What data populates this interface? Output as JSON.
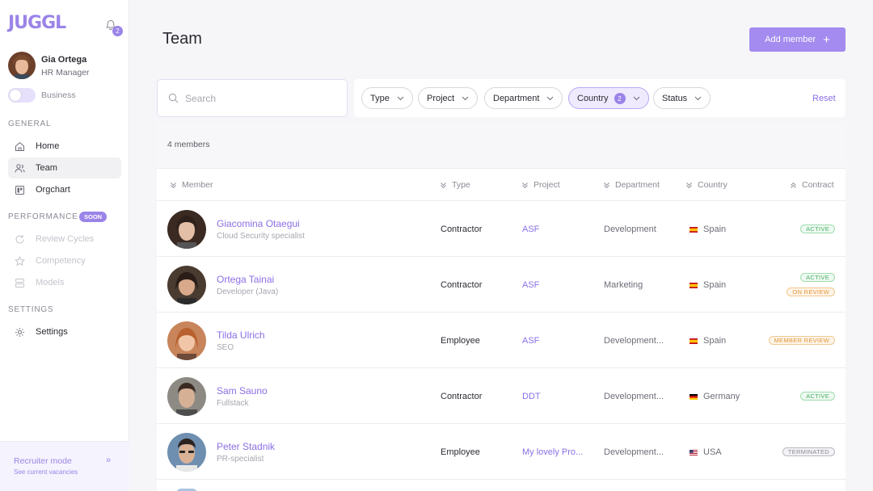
{
  "app": {
    "logo": "JUGGL",
    "notifications_count": "2"
  },
  "user": {
    "name": "Gia Ortega",
    "role": "HR Manager",
    "mode_label": "Business"
  },
  "sidebar": {
    "general_title": "GENERAL",
    "performance_title": "PERFORMANCE",
    "soon_label": "SOON",
    "settings_title": "SETTINGS",
    "items": [
      {
        "label": "Home",
        "icon": "home-icon"
      },
      {
        "label": "Team",
        "icon": "team-icon",
        "active": true
      },
      {
        "label": "Orgchart",
        "icon": "orgchart-icon"
      },
      {
        "label": "Review Cycles",
        "icon": "refresh-icon",
        "disabled": true
      },
      {
        "label": "Competency",
        "icon": "star-icon",
        "disabled": true
      },
      {
        "label": "Models",
        "icon": "models-icon",
        "disabled": true
      },
      {
        "label": "Settings",
        "icon": "gear-icon"
      }
    ],
    "recruiter": {
      "title": "Recruiter mode",
      "subtitle": "See current vacancies"
    }
  },
  "header": {
    "title": "Team",
    "add_button": "Add member"
  },
  "search": {
    "placeholder": "Search"
  },
  "filters": {
    "chips": [
      {
        "label": "Type"
      },
      {
        "label": "Project"
      },
      {
        "label": "Department"
      },
      {
        "label": "Country",
        "count": "2",
        "selected": true
      },
      {
        "label": "Status"
      }
    ],
    "reset_label": "Reset"
  },
  "table": {
    "count_label": "4 members",
    "columns": [
      "Member",
      "Type",
      "Project",
      "Department",
      "Country",
      "Contract"
    ],
    "rows": [
      {
        "name": "Giacomina Otaegui",
        "role": "Cloud Security specialist",
        "type": "Contractor",
        "project": "ASF",
        "department": "Development",
        "country": "Spain",
        "statuses": [
          "ACTIVE"
        ]
      },
      {
        "name": "Ortega Tainai",
        "role": "Developer (Java)",
        "type": "Contractor",
        "project": "ASF",
        "department": "Marketing",
        "country": "Spain",
        "statuses": [
          "ACTIVE",
          "ON REVIEW"
        ]
      },
      {
        "name": "Tilda Ulrich",
        "role": "SEO",
        "type": "Employee",
        "project": "ASF",
        "department": "Development...",
        "country": "Spain",
        "statuses": [
          "MEMBER REVIEW"
        ]
      },
      {
        "name": "Sam Sauno",
        "role": "Fullstack",
        "type": "Contractor",
        "project": "DDT",
        "department": "Development...",
        "country": "Germany",
        "statuses": [
          "ACTIVE"
        ]
      },
      {
        "name": "Peter Stadnik",
        "role": "PR-specialist",
        "type": "Employee",
        "project": "My lovely Pro...",
        "department": "Development...",
        "country": "USA",
        "statuses": [
          "TERMINATED"
        ]
      }
    ]
  },
  "colors": {
    "accent": "#9b84e8",
    "active": "#4caf66",
    "review": "#e3973a",
    "terminated": "#8a8a95"
  }
}
